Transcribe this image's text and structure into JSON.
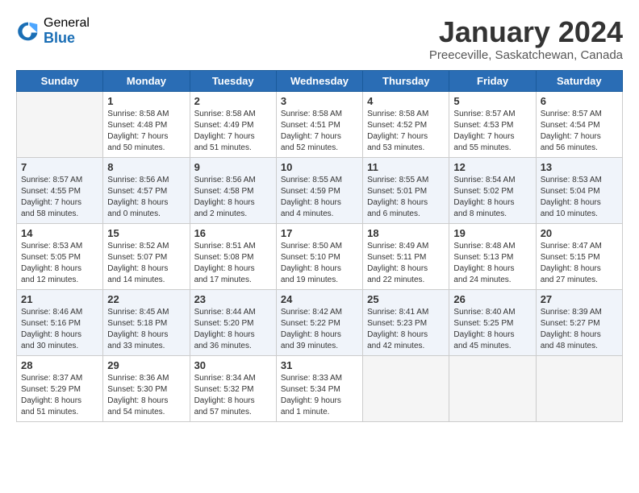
{
  "logo": {
    "general": "General",
    "blue": "Blue"
  },
  "header": {
    "month": "January 2024",
    "location": "Preeceville, Saskatchewan, Canada"
  },
  "weekdays": [
    "Sunday",
    "Monday",
    "Tuesday",
    "Wednesday",
    "Thursday",
    "Friday",
    "Saturday"
  ],
  "weeks": [
    [
      {
        "day": "",
        "info": ""
      },
      {
        "day": "1",
        "info": "Sunrise: 8:58 AM\nSunset: 4:48 PM\nDaylight: 7 hours\nand 50 minutes."
      },
      {
        "day": "2",
        "info": "Sunrise: 8:58 AM\nSunset: 4:49 PM\nDaylight: 7 hours\nand 51 minutes."
      },
      {
        "day": "3",
        "info": "Sunrise: 8:58 AM\nSunset: 4:51 PM\nDaylight: 7 hours\nand 52 minutes."
      },
      {
        "day": "4",
        "info": "Sunrise: 8:58 AM\nSunset: 4:52 PM\nDaylight: 7 hours\nand 53 minutes."
      },
      {
        "day": "5",
        "info": "Sunrise: 8:57 AM\nSunset: 4:53 PM\nDaylight: 7 hours\nand 55 minutes."
      },
      {
        "day": "6",
        "info": "Sunrise: 8:57 AM\nSunset: 4:54 PM\nDaylight: 7 hours\nand 56 minutes."
      }
    ],
    [
      {
        "day": "7",
        "info": "Sunrise: 8:57 AM\nSunset: 4:55 PM\nDaylight: 7 hours\nand 58 minutes."
      },
      {
        "day": "8",
        "info": "Sunrise: 8:56 AM\nSunset: 4:57 PM\nDaylight: 8 hours\nand 0 minutes."
      },
      {
        "day": "9",
        "info": "Sunrise: 8:56 AM\nSunset: 4:58 PM\nDaylight: 8 hours\nand 2 minutes."
      },
      {
        "day": "10",
        "info": "Sunrise: 8:55 AM\nSunset: 4:59 PM\nDaylight: 8 hours\nand 4 minutes."
      },
      {
        "day": "11",
        "info": "Sunrise: 8:55 AM\nSunset: 5:01 PM\nDaylight: 8 hours\nand 6 minutes."
      },
      {
        "day": "12",
        "info": "Sunrise: 8:54 AM\nSunset: 5:02 PM\nDaylight: 8 hours\nand 8 minutes."
      },
      {
        "day": "13",
        "info": "Sunrise: 8:53 AM\nSunset: 5:04 PM\nDaylight: 8 hours\nand 10 minutes."
      }
    ],
    [
      {
        "day": "14",
        "info": "Sunrise: 8:53 AM\nSunset: 5:05 PM\nDaylight: 8 hours\nand 12 minutes."
      },
      {
        "day": "15",
        "info": "Sunrise: 8:52 AM\nSunset: 5:07 PM\nDaylight: 8 hours\nand 14 minutes."
      },
      {
        "day": "16",
        "info": "Sunrise: 8:51 AM\nSunset: 5:08 PM\nDaylight: 8 hours\nand 17 minutes."
      },
      {
        "day": "17",
        "info": "Sunrise: 8:50 AM\nSunset: 5:10 PM\nDaylight: 8 hours\nand 19 minutes."
      },
      {
        "day": "18",
        "info": "Sunrise: 8:49 AM\nSunset: 5:11 PM\nDaylight: 8 hours\nand 22 minutes."
      },
      {
        "day": "19",
        "info": "Sunrise: 8:48 AM\nSunset: 5:13 PM\nDaylight: 8 hours\nand 24 minutes."
      },
      {
        "day": "20",
        "info": "Sunrise: 8:47 AM\nSunset: 5:15 PM\nDaylight: 8 hours\nand 27 minutes."
      }
    ],
    [
      {
        "day": "21",
        "info": "Sunrise: 8:46 AM\nSunset: 5:16 PM\nDaylight: 8 hours\nand 30 minutes."
      },
      {
        "day": "22",
        "info": "Sunrise: 8:45 AM\nSunset: 5:18 PM\nDaylight: 8 hours\nand 33 minutes."
      },
      {
        "day": "23",
        "info": "Sunrise: 8:44 AM\nSunset: 5:20 PM\nDaylight: 8 hours\nand 36 minutes."
      },
      {
        "day": "24",
        "info": "Sunrise: 8:42 AM\nSunset: 5:22 PM\nDaylight: 8 hours\nand 39 minutes."
      },
      {
        "day": "25",
        "info": "Sunrise: 8:41 AM\nSunset: 5:23 PM\nDaylight: 8 hours\nand 42 minutes."
      },
      {
        "day": "26",
        "info": "Sunrise: 8:40 AM\nSunset: 5:25 PM\nDaylight: 8 hours\nand 45 minutes."
      },
      {
        "day": "27",
        "info": "Sunrise: 8:39 AM\nSunset: 5:27 PM\nDaylight: 8 hours\nand 48 minutes."
      }
    ],
    [
      {
        "day": "28",
        "info": "Sunrise: 8:37 AM\nSunset: 5:29 PM\nDaylight: 8 hours\nand 51 minutes."
      },
      {
        "day": "29",
        "info": "Sunrise: 8:36 AM\nSunset: 5:30 PM\nDaylight: 8 hours\nand 54 minutes."
      },
      {
        "day": "30",
        "info": "Sunrise: 8:34 AM\nSunset: 5:32 PM\nDaylight: 8 hours\nand 57 minutes."
      },
      {
        "day": "31",
        "info": "Sunrise: 8:33 AM\nSunset: 5:34 PM\nDaylight: 9 hours\nand 1 minute."
      },
      {
        "day": "",
        "info": ""
      },
      {
        "day": "",
        "info": ""
      },
      {
        "day": "",
        "info": ""
      }
    ]
  ]
}
